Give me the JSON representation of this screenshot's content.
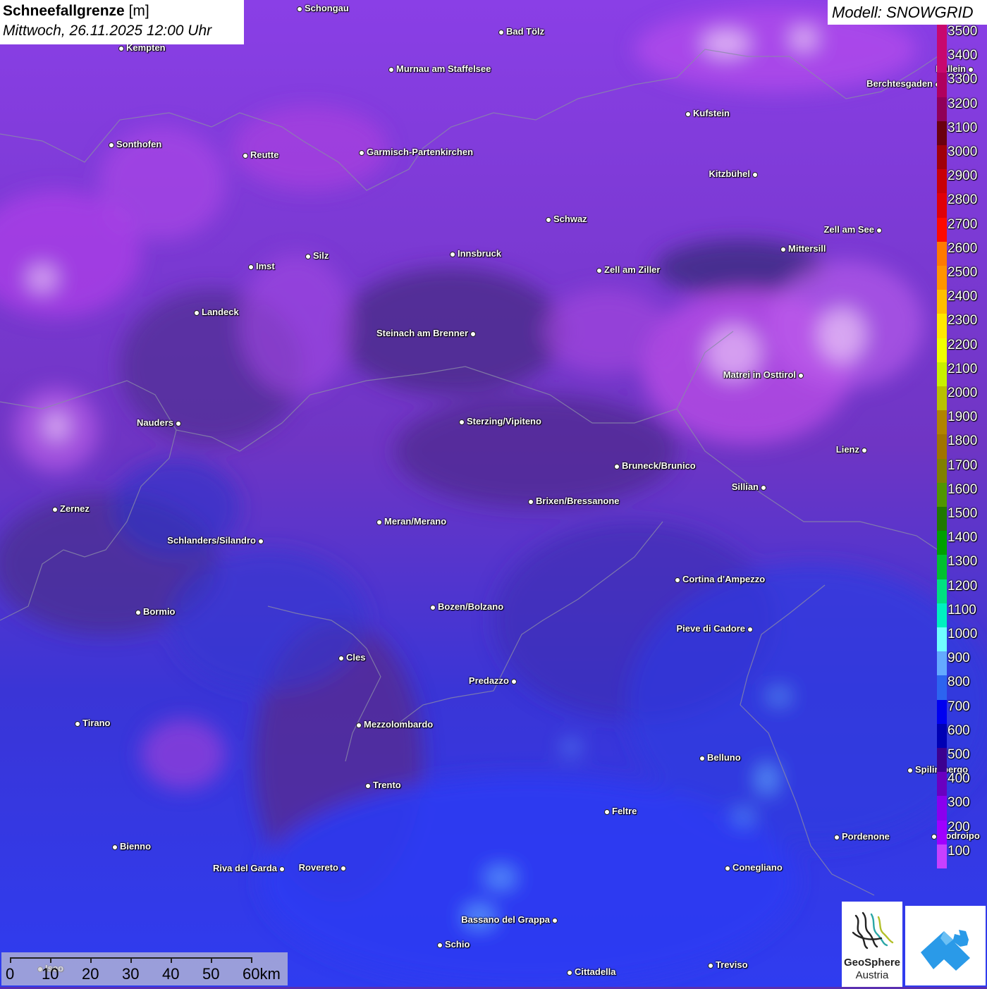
{
  "title": {
    "variable": "Schneefallgrenze",
    "unit": "[m]",
    "datetime": "Mittwoch, 26.11.2025 12:00 Uhr"
  },
  "model": "Modell: SNOWGRID",
  "legend": {
    "labels": [
      "3500",
      "3400",
      "3300",
      "3200",
      "3100",
      "3000",
      "2900",
      "2800",
      "2700",
      "2600",
      "2500",
      "2400",
      "2300",
      "2200",
      "2100",
      "2000",
      "1900",
      "1800",
      "1700",
      "1600",
      "1500",
      "1400",
      "1300",
      "1200",
      "1100",
      "1000",
      "900",
      "800",
      "700",
      "600",
      "500",
      "400",
      "300",
      "200",
      "100"
    ],
    "colors": [
      "#c8086e",
      "#c8086e",
      "#b0005e",
      "#900058",
      "#6a0010",
      "#a0000a",
      "#c80008",
      "#e00008",
      "#ff0a00",
      "#ff7a00",
      "#ff9400",
      "#ffbe00",
      "#ffe800",
      "#f0ff00",
      "#c8f000",
      "#b8c000",
      "#b08400",
      "#a07400",
      "#808000",
      "#509600",
      "#207800",
      "#00a000",
      "#00c030",
      "#00e080",
      "#00f0c0",
      "#70ffff",
      "#64aaff",
      "#2c64f0",
      "#0000f0",
      "#0000b4",
      "#3c0090",
      "#6a00c0",
      "#8a00ee",
      "#a000ff",
      "#c840ff"
    ]
  },
  "cities": [
    {
      "name": "Schongau"
    },
    {
      "name": "Bad Tölz"
    },
    {
      "name": "Kempten"
    },
    {
      "name": "Murnau am Staffelsee"
    },
    {
      "name": "Berchtesgaden"
    },
    {
      "name": "Kufstein"
    },
    {
      "name": "Sonthofen"
    },
    {
      "name": "Reutte"
    },
    {
      "name": "Garmisch-Partenkirchen"
    },
    {
      "name": "Kitzbühel"
    },
    {
      "name": "Schwaz"
    },
    {
      "name": "Zell am See"
    },
    {
      "name": "Mittersill"
    },
    {
      "name": "Innsbruck"
    },
    {
      "name": "Silz"
    },
    {
      "name": "Imst"
    },
    {
      "name": "Zell am Ziller"
    },
    {
      "name": "Landeck"
    },
    {
      "name": "Steinach am Brenner"
    },
    {
      "name": "Matrei in Osttirol"
    },
    {
      "name": "Nauders"
    },
    {
      "name": "Sterzing/Vipiteno"
    },
    {
      "name": "Lienz"
    },
    {
      "name": "Bruneck/Brunico"
    },
    {
      "name": "Sillian"
    },
    {
      "name": "Brixen/Bressanone"
    },
    {
      "name": "Zernez"
    },
    {
      "name": "Meran/Merano"
    },
    {
      "name": "Schlanders/Silandro"
    },
    {
      "name": "Cortina d'Ampezzo"
    },
    {
      "name": "Bozen/Bolzano"
    },
    {
      "name": "Bormio"
    },
    {
      "name": "Pieve di Cadore"
    },
    {
      "name": "Cles"
    },
    {
      "name": "Predazzo"
    },
    {
      "name": "Tirano"
    },
    {
      "name": "Mezzolombardo"
    },
    {
      "name": "Belluno"
    },
    {
      "name": "Trento"
    },
    {
      "name": "Feltre"
    },
    {
      "name": "Pordenone"
    },
    {
      "name": "Bienno"
    },
    {
      "name": "Riva del Garda"
    },
    {
      "name": "Rovereto"
    },
    {
      "name": "Conegliano"
    },
    {
      "name": "Bassano del Grappa"
    },
    {
      "name": "Schio"
    },
    {
      "name": "Treviso"
    },
    {
      "name": "Cittadella"
    },
    {
      "name": "Hallein"
    },
    {
      "name": "Spilimbergo"
    },
    {
      "name": "Codroipo"
    },
    {
      "name": "Iseo"
    }
  ],
  "scalebar": {
    "labels": [
      "0",
      "10",
      "20",
      "30",
      "40",
      "50",
      "60km"
    ]
  },
  "logos": {
    "geosphere_name": "GeoSphere",
    "geosphere_sub": "Austria"
  }
}
